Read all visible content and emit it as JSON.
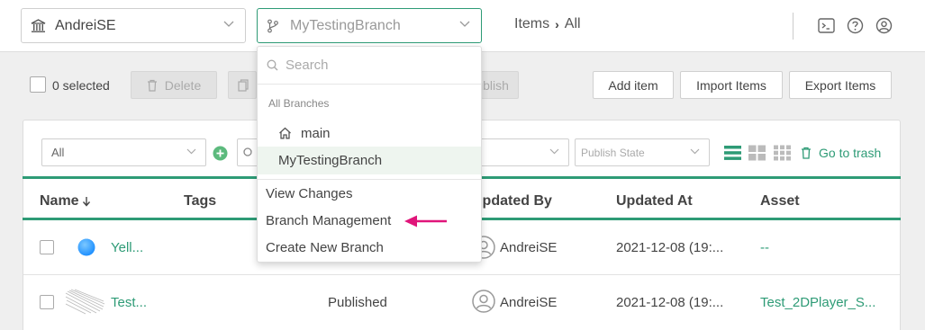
{
  "topbar": {
    "org": {
      "label": "AndreiSE",
      "icon": "bank-icon"
    },
    "branch": {
      "label": "MyTestingBranch",
      "icon": "branch-icon"
    },
    "breadcrumb": {
      "items_label": "Items",
      "separator": "›",
      "current": "All"
    },
    "icons": [
      "terminal-icon",
      "help-icon",
      "user-icon"
    ]
  },
  "toolbar": {
    "selected_count": "0 selected",
    "delete_label": "Delete",
    "publish_label": "Publish",
    "add_item_label": "Add item",
    "import_label": "Import Items",
    "export_label": "Export Items"
  },
  "filters": {
    "type_value": "All",
    "publish_state_placeholder": "Publish State",
    "go_to_trash_label": "Go to trash"
  },
  "table": {
    "columns": {
      "name": "Name",
      "tags": "Tags",
      "updated_by": "Updated By",
      "updated_at": "Updated At",
      "asset": "Asset"
    },
    "rows": [
      {
        "name": "Yell...",
        "status": "",
        "updated_by": "AndreiSE",
        "updated_at": "2021-12-08 (19:...",
        "asset": "--"
      },
      {
        "name": "Test...",
        "status": "Published",
        "updated_by": "AndreiSE",
        "updated_at": "2021-12-08 (19:...",
        "asset": "Test_2DPlayer_S..."
      }
    ]
  },
  "branch_menu": {
    "search_placeholder": "Search",
    "group_label": "All Branches",
    "branches": [
      "main",
      "MyTestingBranch"
    ],
    "actions": [
      "View Changes",
      "Branch Management",
      "Create New Branch"
    ]
  },
  "colors": {
    "accent": "#2e9b76",
    "arrow": "#e0157a"
  }
}
